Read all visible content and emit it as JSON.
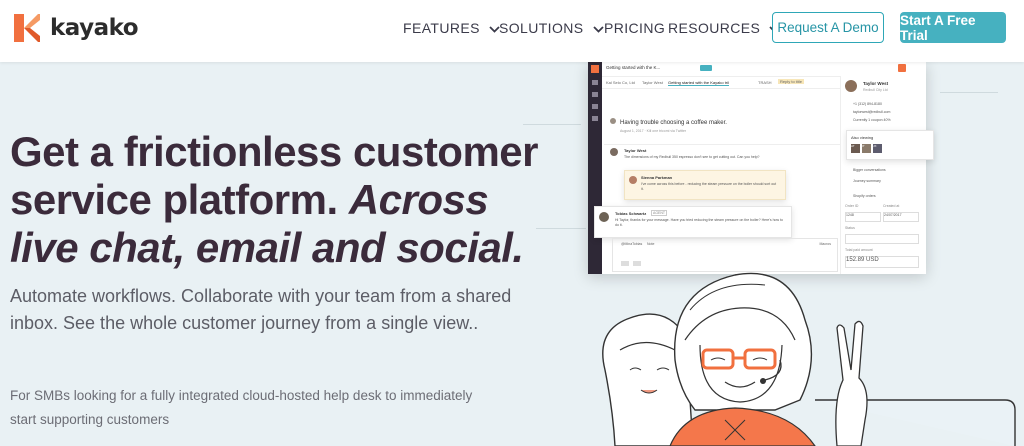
{
  "brand": {
    "name": "kayako",
    "colors": {
      "accent": "#46b1c0",
      "logo_orange": "#f1703f"
    }
  },
  "nav": {
    "features": "FEATURES",
    "solutions": "SOLUTIONS",
    "pricing": "PRICING",
    "resources": "RESOURCES",
    "demo_button": "Request A Demo",
    "trial_button": "Start A Free Trial"
  },
  "hero": {
    "headline_line1": "Get a frictionless customer",
    "headline_line2a": "service platform. ",
    "headline_line2b": "Across",
    "headline_line3": "live chat, email and social.",
    "subtext": "Automate workflows. Collaborate with your team from a shared inbox. See the whole customer journey from a single view..",
    "note": "For SMBs looking for a fully integrated cloud-hosted help desk to immediately start supporting customers"
  },
  "app_preview": {
    "case_title": "Getting started with the K...",
    "tabs": [
      "Kal Selo Co, Ltd",
      "Taylor West",
      "Getting started with the Kayako tril",
      "TRASH",
      "Reply to title"
    ],
    "conversation_subject": "Having trouble choosing a coffee maker.",
    "conversation_meta": "August 1, 2017 · Kill one tricomi via Twitter",
    "msg1_author": "Taylor West",
    "msg1_text": "The dimensions of my Redbull 350 espresso don't see to get cutting out. Can you help?",
    "msg2_author": "Sienna Parkman",
    "msg2_text": "I've come across this before - reducing the steam pressure on the boiler should sort out it.",
    "msg3_author": "Tobias Schwartz",
    "msg3_badge": "AGENT",
    "msg3_text": "Hi Taylor, thanks for your message. Have you tried reducing the steam pressure on the boiler? Here's how to do it.",
    "reply_to": "@MinaTobias",
    "reply_note": "Note",
    "reply_macros": "Macros",
    "profile_name": "Taylor West",
    "profile_sub": "Redbull City Ltd",
    "profile_phone": "+1 (312) 894-8180",
    "profile_email": "taylorwest@redbull.com",
    "profile_extra": "Currently 1 coupon 40%",
    "also_viewing": "Also viewing",
    "viewing_initials": [
      "AT",
      "IT",
      "JX"
    ],
    "organization_label": "Organization",
    "conversations_label": "Bigger conversations",
    "journey_label": "Journey summary",
    "shopify_label": "Shopify orders",
    "order_label": "Order ID",
    "created_label": "Created at",
    "order_value": "1248",
    "created_value": "24/07/2017",
    "status_label": "Status",
    "total_label": "Total paid amount",
    "total_value": "152.89 USD"
  }
}
